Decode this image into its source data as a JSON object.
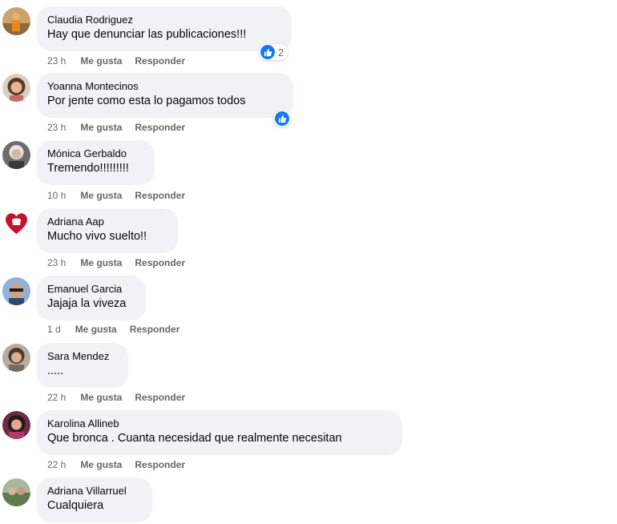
{
  "colors": {
    "bubble": "#f0f2f5",
    "meta_text": "#65676b",
    "like_blue": "#1877f2"
  },
  "comments": [
    {
      "author": "Claudia Rodriguez",
      "text": "Hay que denunciar las publicaciones!!!",
      "time": "23 h",
      "like": "Me gusta",
      "reply": "Responder",
      "reactions": "2",
      "avatar_icon": "avatar-photo"
    },
    {
      "author": "Yoanna Montecinos",
      "text": "Por jente como esta lo pagamos todos",
      "time": "23 h",
      "like": "Me gusta",
      "reply": "Responder",
      "avatar_icon": "avatar-photo"
    },
    {
      "author": "Mónica Gerbaldo",
      "text": "Tremendo!!!!!!!!!",
      "time": "10 h",
      "like": "Me gusta",
      "reply": "Responder",
      "avatar_icon": "avatar-photo"
    },
    {
      "author": "Adriana Aap",
      "text": "Mucho vivo suelto!!",
      "time": "23 h",
      "like": "Me gusta",
      "reply": "Responder",
      "avatar_icon": "heart-avatar"
    },
    {
      "author": "Emanuel Garcia",
      "text": "Jajaja la viveza",
      "time": "1 d",
      "like": "Me gusta",
      "reply": "Responder",
      "avatar_icon": "avatar-photo"
    },
    {
      "author": "Sara Mendez",
      "text": ".....",
      "time": "22 h",
      "like": "Me gusta",
      "reply": "Responder",
      "avatar_icon": "avatar-photo"
    },
    {
      "author": "Karolina Allineb",
      "text": "Que bronca . Cuanta necesidad que realmente necesitan",
      "time": "22 h",
      "like": "Me gusta",
      "reply": "Responder",
      "avatar_icon": "avatar-photo"
    },
    {
      "author": "Adriana Villarruel",
      "text": "Cualquiera",
      "avatar_icon": "avatar-photo"
    }
  ]
}
